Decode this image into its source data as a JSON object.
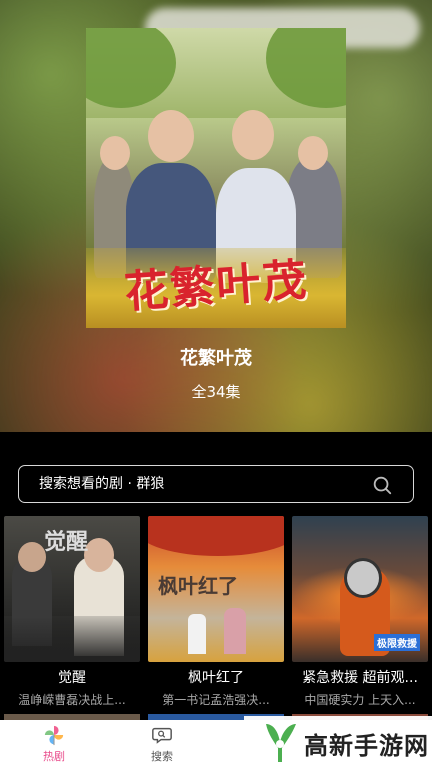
{
  "hero": {
    "poster_title": "花繁叶茂",
    "show_title": "花繁叶茂",
    "episodes": "全34集"
  },
  "search": {
    "placeholder": "搜索想看的剧 · 群狼",
    "icon": "search-icon"
  },
  "cards": [
    {
      "name": "觉醒",
      "desc": "温峥嵘曹磊决战上...",
      "poster_text": "觉醒"
    },
    {
      "name": "枫叶红了",
      "desc": "第一书记孟浩强决...",
      "poster_text": "枫叶红了"
    },
    {
      "name": "紧急救援 超前观...",
      "desc": "中国硬实力 上天入...",
      "poster_text": "极限救援"
    }
  ],
  "tabbar": {
    "items": [
      {
        "label": "热剧",
        "icon": "pinwheel-icon",
        "active": true
      },
      {
        "label": "搜索",
        "icon": "search-chat-icon",
        "active": false
      }
    ],
    "active_color": "#e84a8a",
    "inactive_color": "#555555"
  },
  "watermark": {
    "text": "高新手游网",
    "logo_color": "#4caf50"
  }
}
